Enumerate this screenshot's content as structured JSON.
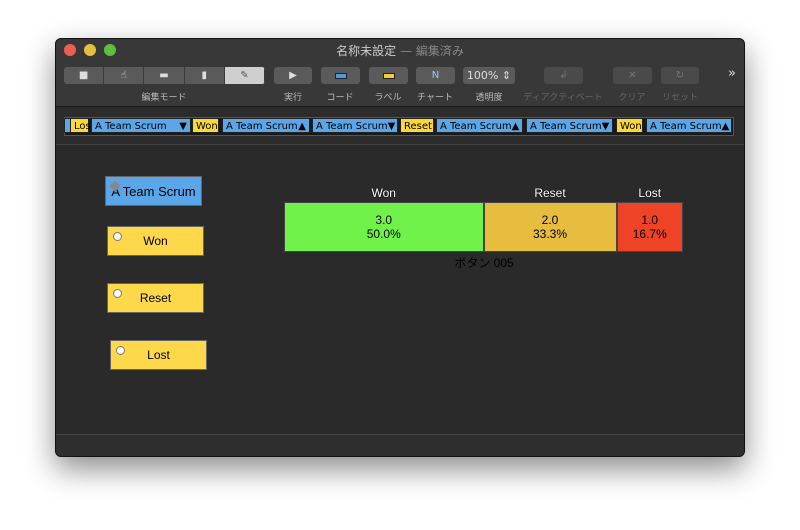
{
  "window": {
    "title": "名称未設定",
    "title_suffix": "— 編集済み"
  },
  "toolbar": {
    "mode_segments": [
      {
        "icon": "video-icon"
      },
      {
        "icon": "hand-pointer-icon"
      },
      {
        "icon": "button-icon"
      },
      {
        "icon": "bar-chart-icon"
      },
      {
        "icon": "pencil-icon",
        "selected": true
      }
    ],
    "mode_label": "編集モード",
    "run_label": "実行",
    "code_label": "コード",
    "label_label": "ラベル",
    "chart_label": "チャート",
    "opacity_label": "透明度",
    "opacity_value": "100%",
    "deactivate_label": "ディアクティベート",
    "clear_label": "クリア",
    "reset_label": "リセット",
    "overflow": "»"
  },
  "sequence": [
    {
      "label": "",
      "color": "blue"
    },
    {
      "label": "Lost",
      "color": "yellow"
    },
    {
      "label": "A Team Scrum",
      "arrow": "▼",
      "color": "blue"
    },
    {
      "label": "Won",
      "color": "yellow"
    },
    {
      "label": "A Team Scrum",
      "arrow": "▲",
      "color": "blue"
    },
    {
      "label": "A Team Scrum",
      "arrow": "▼",
      "color": "blue"
    },
    {
      "label": "Reset",
      "color": "yellow"
    },
    {
      "label": "A Team Scrum",
      "arrow": "▲",
      "color": "blue"
    },
    {
      "label": "A Team Scrum",
      "arrow": "▼",
      "color": "blue"
    },
    {
      "label": "Won",
      "color": "yellow"
    },
    {
      "label": "A Team Scrum",
      "arrow": "▲",
      "color": "blue"
    }
  ],
  "canvas": {
    "team_button": "A Team Scrum",
    "buttons": [
      "Won",
      "Reset",
      "Lost"
    ],
    "chart_caption": "ボタン 005"
  },
  "chart_data": {
    "type": "bar",
    "stacked": true,
    "orientation": "horizontal",
    "categories": [
      "Won",
      "Reset",
      "Lost"
    ],
    "values": [
      3.0,
      2.0,
      1.0
    ],
    "value_labels": [
      "3.0",
      "2.0",
      "1.0"
    ],
    "percent_labels": [
      "50.0%",
      "33.3%",
      "16.7%"
    ],
    "colors": [
      "#70f24a",
      "#e6bd3e",
      "#ee4326"
    ],
    "title": "ボタン 005"
  }
}
